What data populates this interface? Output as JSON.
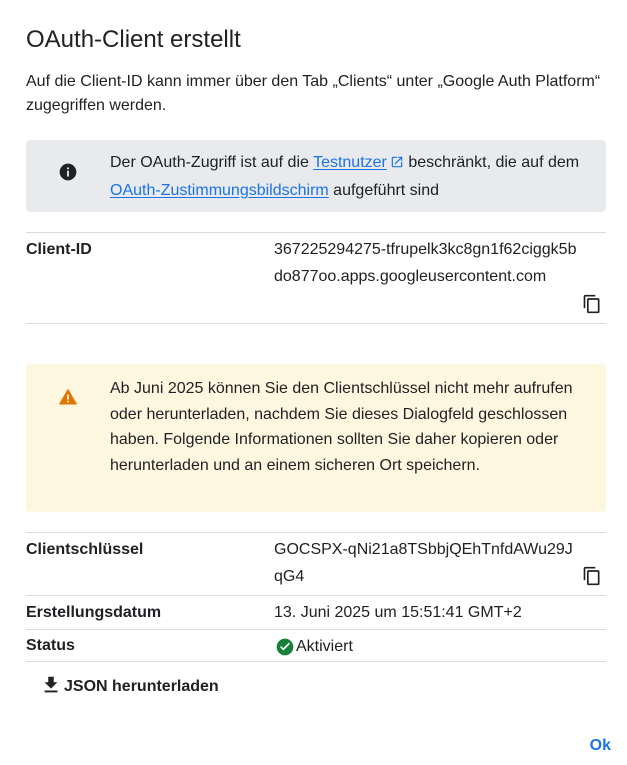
{
  "dialog": {
    "title": "OAuth-Client erstellt",
    "intro": "Auf die Client-ID kann immer über den Tab „Clients“ unter „Google Auth Platform“ zugegriffen werden."
  },
  "info_banner": {
    "icon": "info-icon",
    "text_before": "Der OAuth-Zugriff ist auf die ",
    "link1": "Testnutzer",
    "text_middle": " beschränkt, die auf dem ",
    "link2": "OAuth-Zustimmungsbildschirm",
    "text_after": " aufgeführt sind"
  },
  "client_id": {
    "label": "Client-ID",
    "value": "367225294275-tfrupelk3kc8gn1f62ciggk5bdo877oo.apps.googleusercontent.com",
    "copy_icon": "copy-icon"
  },
  "warning_banner": {
    "icon": "warning-icon",
    "text": "Ab Juni 2025 können Sie den Clientschlüssel nicht mehr aufrufen oder herunterladen, nachdem Sie dieses Dialogfeld geschlossen haben. Folgende Informationen sollten Sie daher kopieren oder herunterladen und an einem sicheren Ort speichern."
  },
  "client_secret": {
    "label": "Clientschlüssel",
    "value": "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",
    "copy_icon": "copy-icon"
  },
  "created": {
    "label": "Erstellungsdatum",
    "value": "13. Juni 2025 um 15:51:41 GMT+2"
  },
  "status": {
    "label": "Status",
    "value": "Aktiviert",
    "icon": "check-circle-icon",
    "color": "#188038"
  },
  "actions": {
    "download_label": "JSON herunterladen",
    "download_icon": "download-icon",
    "ok_label": "Ok"
  },
  "colors": {
    "link": "#1a73e8",
    "info_bg": "#e8eaed",
    "warn_bg": "#fef7e0",
    "warn_icon": "#e37400"
  }
}
